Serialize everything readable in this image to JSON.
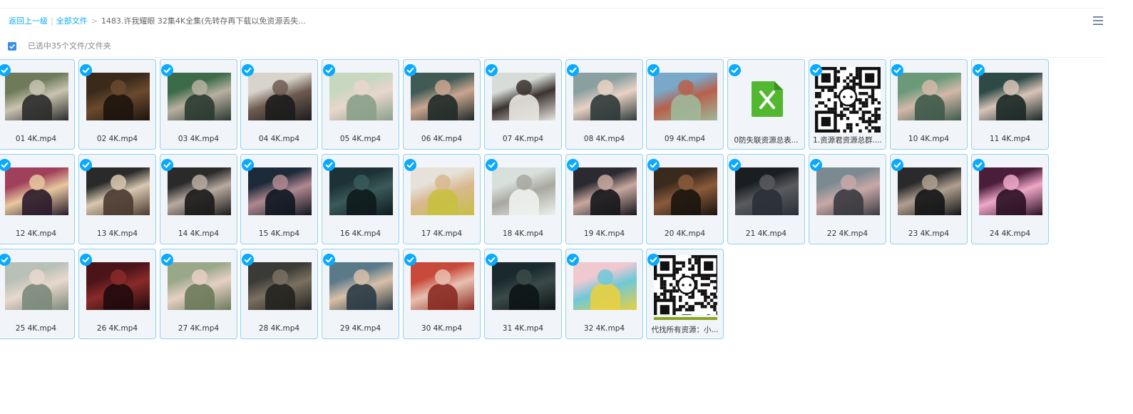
{
  "breadcrumb": {
    "back": "返回上一级",
    "sep": "|",
    "all_files": "全部文件",
    "gt": ">",
    "current": "1483.许我耀眼 32集4K全集(先转存再下载以免资源丢失..."
  },
  "select_bar": {
    "count_text": "已选中35个文件/文件夹"
  },
  "files": [
    {
      "name": "01 4K.mp4",
      "kind": "video",
      "colors": [
        "#6e7a5a",
        "#c9c4b0",
        "#2b2b2b"
      ]
    },
    {
      "name": "02 4K.mp4",
      "kind": "video",
      "colors": [
        "#3a2a1a",
        "#6b4a2e",
        "#1c140d"
      ]
    },
    {
      "name": "03 4K.mp4",
      "kind": "video",
      "colors": [
        "#3c6b4a",
        "#b8b0a0",
        "#2a3a30"
      ]
    },
    {
      "name": "04 4K.mp4",
      "kind": "video",
      "colors": [
        "#d8d4cc",
        "#6d5a50",
        "#1c1c1c"
      ]
    },
    {
      "name": "05 4K.mp4",
      "kind": "video",
      "colors": [
        "#c7d7c0",
        "#e8d6cc",
        "#8aa08a"
      ]
    },
    {
      "name": "06 4K.mp4",
      "kind": "video",
      "colors": [
        "#405a55",
        "#c9a690",
        "#1f2a28"
      ]
    },
    {
      "name": "07 4K.mp4",
      "kind": "video",
      "colors": [
        "#d7dcd8",
        "#3b3330",
        "#e9e6e0"
      ]
    },
    {
      "name": "08 4K.mp4",
      "kind": "video",
      "colors": [
        "#8aa0a0",
        "#e8d2c4",
        "#2e3a3a"
      ]
    },
    {
      "name": "09 4K.mp4",
      "kind": "video",
      "colors": [
        "#7aa8c8",
        "#b8604a",
        "#9fb89a"
      ]
    },
    {
      "name": "0防失联资源总表...",
      "kind": "xlsx",
      "colors": []
    },
    {
      "name": "1.资源君资源总群....",
      "kind": "qr",
      "colors": []
    },
    {
      "name": "10 4K.mp4",
      "kind": "video",
      "colors": [
        "#6a9a7a",
        "#d2b8a8",
        "#3e5a4a"
      ]
    },
    {
      "name": "11 4K.mp4",
      "kind": "video",
      "colors": [
        "#2e4a46",
        "#d8c4b8",
        "#1a2826"
      ]
    },
    {
      "name": "12 4K.mp4",
      "kind": "video",
      "colors": [
        "#a0405a",
        "#e6c8a0",
        "#2a1a2a"
      ]
    },
    {
      "name": "13 4K.mp4",
      "kind": "video",
      "colors": [
        "#2a2a2a",
        "#d8c8b0",
        "#4a3a30"
      ]
    },
    {
      "name": "14 4K.mp4",
      "kind": "video",
      "colors": [
        "#2a2a2a",
        "#b8aaa0",
        "#1a1a1a"
      ]
    },
    {
      "name": "15 4K.mp4",
      "kind": "video",
      "colors": [
        "#1c2a3a",
        "#b08890",
        "#0e1620"
      ]
    },
    {
      "name": "16 4K.mp4",
      "kind": "video",
      "colors": [
        "#1c3236",
        "#3a5a5a",
        "#0e1a1c"
      ]
    },
    {
      "name": "17 4K.mp4",
      "kind": "video",
      "colors": [
        "#e6e2da",
        "#d8b890",
        "#c8c040"
      ]
    },
    {
      "name": "18 4K.mp4",
      "kind": "video",
      "colors": [
        "#d8e0dc",
        "#a8a8a0",
        "#eef2ef"
      ]
    },
    {
      "name": "19 4K.mp4",
      "kind": "video",
      "colors": [
        "#2a2a30",
        "#c8a8a0",
        "#16161a"
      ]
    },
    {
      "name": "20 4K.mp4",
      "kind": "video",
      "colors": [
        "#3a2a1e",
        "#8a5a3a",
        "#1a140e"
      ]
    },
    {
      "name": "21 4K.mp4",
      "kind": "video",
      "colors": [
        "#1a1e22",
        "#5a5a5e",
        "#2a3036"
      ]
    },
    {
      "name": "22 4K.mp4",
      "kind": "video",
      "colors": [
        "#7a8a90",
        "#c8a8a8",
        "#3a3a40"
      ]
    },
    {
      "name": "23 4K.mp4",
      "kind": "video",
      "colors": [
        "#2a2a2c",
        "#b0a090",
        "#141416"
      ]
    },
    {
      "name": "24 4K.mp4",
      "kind": "video",
      "colors": [
        "#4a1e3a",
        "#f0a8c8",
        "#2a1022"
      ]
    },
    {
      "name": "25 4K.mp4",
      "kind": "video",
      "colors": [
        "#b8c0b8",
        "#e8d8cc",
        "#7a8a7a"
      ]
    },
    {
      "name": "26 4K.mp4",
      "kind": "video",
      "colors": [
        "#4a1418",
        "#8a2a2a",
        "#200a0c"
      ]
    },
    {
      "name": "27 4K.mp4",
      "kind": "video",
      "colors": [
        "#9aa88a",
        "#e6d0c4",
        "#6a7a5a"
      ]
    },
    {
      "name": "28 4K.mp4",
      "kind": "video",
      "colors": [
        "#3a3a36",
        "#7a7060",
        "#22221e"
      ]
    },
    {
      "name": "29 4K.mp4",
      "kind": "video",
      "colors": [
        "#5a7a8a",
        "#d8c0a8",
        "#2a3a44"
      ]
    },
    {
      "name": "30 4K.mp4",
      "kind": "video",
      "colors": [
        "#c84a3a",
        "#e8c0b0",
        "#8a2a22"
      ]
    },
    {
      "name": "31 4K.mp4",
      "kind": "video",
      "colors": [
        "#1a2a2c",
        "#3a4a48",
        "#0c1414"
      ]
    },
    {
      "name": "32 4K.mp4",
      "kind": "video",
      "colors": [
        "#f0c8d0",
        "#70c8d8",
        "#e8d040"
      ]
    },
    {
      "name": "代找所有资源：小...",
      "kind": "qr-banner",
      "colors": []
    }
  ],
  "accent_color": "#09aaff",
  "tile_border_color": "#8fd1f3"
}
